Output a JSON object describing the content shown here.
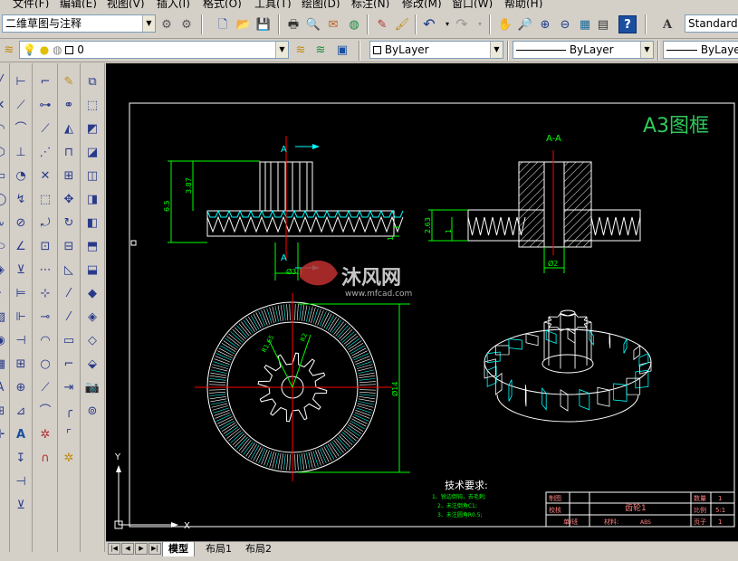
{
  "menu": [
    "文件(F)",
    "编辑(E)",
    "视图(V)",
    "插入(I)",
    "格式(O)",
    "工具(T)",
    "绘图(D)",
    "标注(N)",
    "修改(M)",
    "窗口(W)",
    "帮助(H)"
  ],
  "toolbar": {
    "workspace": "二维草图与注释",
    "text_style": "Standard",
    "layer": "0",
    "color": "ByLayer",
    "linetype": "ByLayer",
    "lineweight": "ByLayer"
  },
  "drawing": {
    "frame_title": "A3图框",
    "section_label": "A-A",
    "view_label_top": "A",
    "view_label_bottom": "A",
    "dim_65": "6.5",
    "dim_387": "3.87",
    "dim_1": "1",
    "dim_263": "2.63",
    "dim_1b": "1",
    "dim_d33": "Ø3.3",
    "dim_d2": "Ø2",
    "dim_d14": "Ø14",
    "dim_r1": "R1.65",
    "dim_r2": "R2",
    "watermark": "沐风网",
    "watermark_url": "www.mfcad.com",
    "axis_x": "X",
    "axis_y": "Y",
    "tech_title": "技术要求:",
    "tech_lines": [
      "1、锐边倒钝，去毛刺;",
      "2、未注倒角C1;",
      "3、未注圆角R0.5;"
    ],
    "titleblock": {
      "draw": "制图",
      "check": "校核",
      "part": "齿轮1",
      "qty_label": "数量",
      "qty": "1",
      "scale_label": "比例",
      "scale": "5:1",
      "dept": "单/班",
      "material_label": "材料:",
      "material": "ABS",
      "sheet_label": "页子",
      "sheet": "1"
    }
  },
  "tabs": [
    "模型",
    "布局1",
    "布局2"
  ],
  "colors": {
    "canvas": "#000000",
    "line": "#ffffff",
    "dim": "#00ff00",
    "center": "#ff0000",
    "hatch": "#00ffff",
    "title": "#31c85a"
  }
}
